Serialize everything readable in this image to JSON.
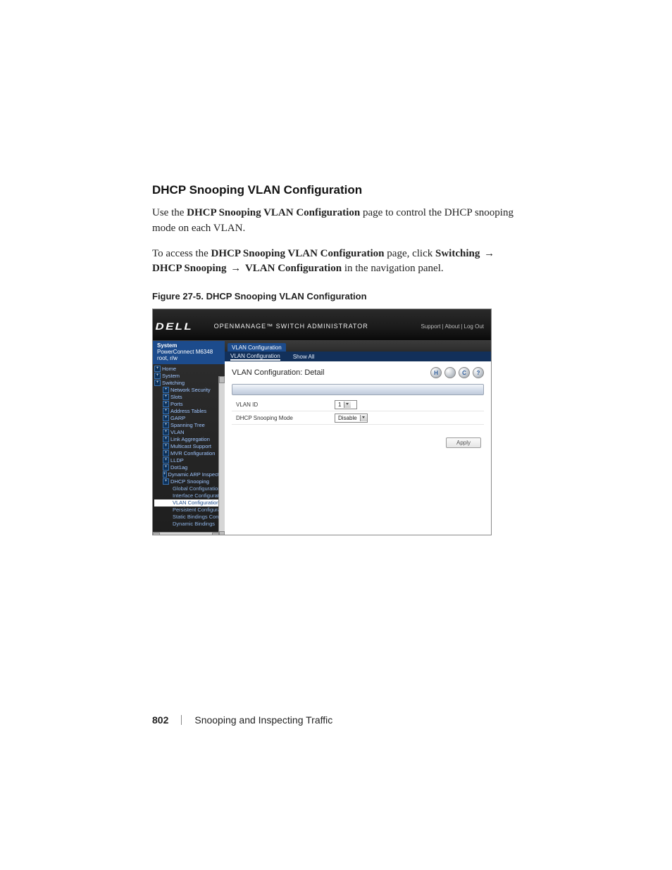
{
  "section": {
    "heading": "DHCP Snooping VLAN Configuration",
    "intro_prefix": "Use the ",
    "intro_bold": "DHCP Snooping VLAN Configuration",
    "intro_suffix": " page to control the DHCP snooping mode on each VLAN.",
    "access_prefix": "To access the ",
    "access_bold1": "DHCP Snooping VLAN Configuration",
    "access_mid1": " page, click ",
    "access_bold2": "Switching",
    "arrow": "→",
    "access_bold3": "DHCP Snooping",
    "access_bold4": "VLAN Configuration",
    "access_suffix": " in the navigation panel."
  },
  "figure": {
    "caption": "Figure 27-5.    DHCP Snooping VLAN Configuration"
  },
  "header": {
    "logo": "DELL",
    "product": "OPENMANAGE™ SWITCH ADMINISTRATOR",
    "links": [
      "Support",
      "About",
      "Log Out"
    ]
  },
  "sidebar": {
    "system_label": "System",
    "device": "PowerConnect M6348",
    "user": "root, r/w",
    "items": [
      {
        "label": "Home",
        "cls": ""
      },
      {
        "label": "System",
        "cls": ""
      },
      {
        "label": "Switching",
        "cls": ""
      },
      {
        "label": "Network Security",
        "cls": "child"
      },
      {
        "label": "Slots",
        "cls": "child"
      },
      {
        "label": "Ports",
        "cls": "child"
      },
      {
        "label": "Address Tables",
        "cls": "child"
      },
      {
        "label": "GARP",
        "cls": "child"
      },
      {
        "label": "Spanning Tree",
        "cls": "child"
      },
      {
        "label": "VLAN",
        "cls": "child"
      },
      {
        "label": "Link Aggregation",
        "cls": "child"
      },
      {
        "label": "Multicast Support",
        "cls": "child"
      },
      {
        "label": "MVR Configuration",
        "cls": "child"
      },
      {
        "label": "LLDP",
        "cls": "child"
      },
      {
        "label": "Dot1ag",
        "cls": "child"
      },
      {
        "label": "Dynamic ARP Inspection",
        "cls": "child"
      },
      {
        "label": "DHCP Snooping",
        "cls": "child"
      },
      {
        "label": "Global Configuration",
        "cls": "gchild"
      },
      {
        "label": "Interface Configuration",
        "cls": "gchild"
      },
      {
        "label": "VLAN Configuration",
        "cls": "gchild sel"
      },
      {
        "label": "Persistent Configuration",
        "cls": "gchild"
      },
      {
        "label": "Static Bindings Configuration",
        "cls": "gchild"
      },
      {
        "label": "Dynamic Bindings",
        "cls": "gchild"
      }
    ]
  },
  "tabs": {
    "top": "VLAN Configuration",
    "sub": [
      "VLAN Configuration",
      "Show All"
    ]
  },
  "content": {
    "title": "VLAN Configuration: Detail",
    "icons": [
      "H",
      "",
      "C",
      "?"
    ],
    "fields": [
      {
        "label": "VLAN ID",
        "value": "1"
      },
      {
        "label": "DHCP Snooping Mode",
        "value": "Disable"
      }
    ],
    "apply": "Apply"
  },
  "footer": {
    "page_number": "802",
    "chapter": "Snooping and Inspecting Traffic"
  }
}
